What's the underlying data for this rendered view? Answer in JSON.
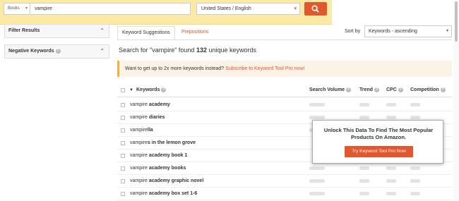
{
  "search_bar": {
    "category": "Books",
    "query": "vampire",
    "country": "United States / English"
  },
  "sidebar": {
    "panels": [
      {
        "label": "Filter Results"
      },
      {
        "label": "Negative Keywords"
      }
    ]
  },
  "tabs": [
    {
      "label": "Keyword Suggestions"
    },
    {
      "label": "Prepositions"
    }
  ],
  "sort": {
    "label": "Sort by",
    "value": "Keywords - ascending"
  },
  "summary": {
    "pre": "Search for \"vampire\" found ",
    "count": "132",
    "post": " unique keywords"
  },
  "banner": {
    "text": "Want to get up to 2x more keywords instead? ",
    "link": "Subscribe to Keyword Tool Pro now!"
  },
  "table": {
    "columns": [
      "Keywords",
      "Search Volume",
      "Trend",
      "CPC",
      "Competition"
    ],
    "rows": [
      {
        "prefix": "vampire",
        "bold": " academy"
      },
      {
        "prefix": "vampire",
        "bold": " diaries"
      },
      {
        "prefix": "vampire",
        "bold": "lla"
      },
      {
        "prefix": "vampire",
        "bold": "s in the lemon grove"
      },
      {
        "prefix": "vampire",
        "bold": " academy book 1"
      },
      {
        "prefix": "vampire",
        "bold": " academy books"
      },
      {
        "prefix": "vampire",
        "bold": " academy graphic novel"
      },
      {
        "prefix": "vampire",
        "bold": " academy box set 1-6"
      }
    ]
  },
  "overlay": {
    "text": "Unlock This Data To Find The Most Popular Products On Amazon.",
    "button": "Try Keyword Tool Pro Now"
  },
  "colors": {
    "accent": "#e2572b",
    "topbar": "#fbe9a6",
    "banner_bg": "#fdf2e6"
  }
}
